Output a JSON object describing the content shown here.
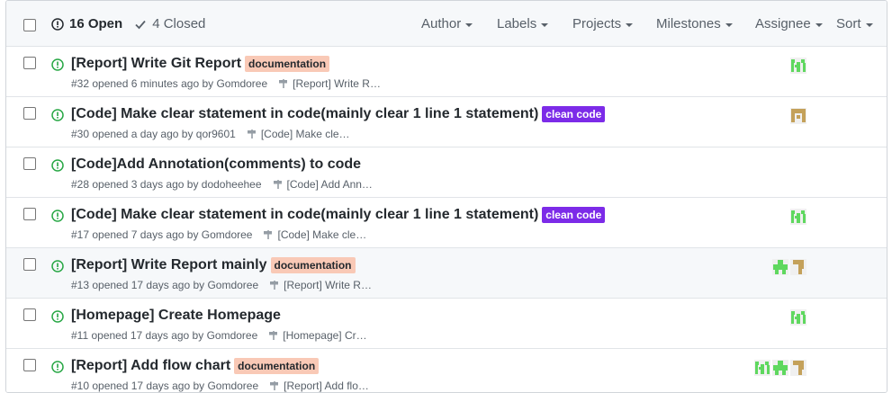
{
  "header": {
    "open_label": "16 Open",
    "closed_label": "4 Closed",
    "filters": [
      "Author",
      "Labels",
      "Projects",
      "Milestones",
      "Assignee",
      "Sort"
    ]
  },
  "colors": {
    "open_green": "#28a745",
    "documentation_label": "#f9c9b6",
    "clean_code_label": "#7c2be8",
    "avatar_green": "#5fd85f",
    "avatar_tan": "#c4a15a"
  },
  "issues": [
    {
      "title": "[Report] Write Git Report",
      "label": {
        "text": "documentation",
        "kind": "documentation"
      },
      "meta": "#32 opened 6 minutes ago by Gomdoree",
      "milestone": "[Report] Write R…",
      "avatars": [
        "green"
      ]
    },
    {
      "title": "[Code] Make clear statement in code(mainly clear 1 line 1 statement)",
      "label": {
        "text": "clean code",
        "kind": "clean"
      },
      "meta": "#30 opened a day ago by qor9601",
      "milestone": "[Code] Make cle…",
      "avatars": [
        "tan"
      ]
    },
    {
      "title": "[Code]Add Annotation(comments) to code",
      "label": null,
      "meta": "#28 opened 3 days ago by dodoheehee",
      "milestone": "[Code] Add Ann…",
      "avatars": []
    },
    {
      "title": "[Code] Make clear statement in code(mainly clear 1 line 1 statement)",
      "label": {
        "text": "clean code",
        "kind": "clean"
      },
      "meta": "#17 opened 7 days ago by Gomdoree",
      "milestone": "[Code] Make cle…",
      "avatars": [
        "green"
      ]
    },
    {
      "title": "[Report] Write Report mainly",
      "label": {
        "text": "documentation",
        "kind": "documentation"
      },
      "meta": "#13 opened 17 days ago by Gomdoree",
      "milestone": "[Report] Write R…",
      "avatars": [
        "green2",
        "tan2"
      ]
    },
    {
      "title": "[Homepage] Create Homepage",
      "label": null,
      "meta": "#11 opened 17 days ago by Gomdoree",
      "milestone": "[Homepage] Cr…",
      "avatars": [
        "green"
      ]
    },
    {
      "title": "[Report] Add flow chart",
      "label": {
        "text": "documentation",
        "kind": "documentation"
      },
      "meta": "#10 opened 17 days ago by Gomdoree",
      "milestone": "[Report] Add flo…",
      "avatars": [
        "green",
        "green2",
        "tan2"
      ]
    }
  ]
}
